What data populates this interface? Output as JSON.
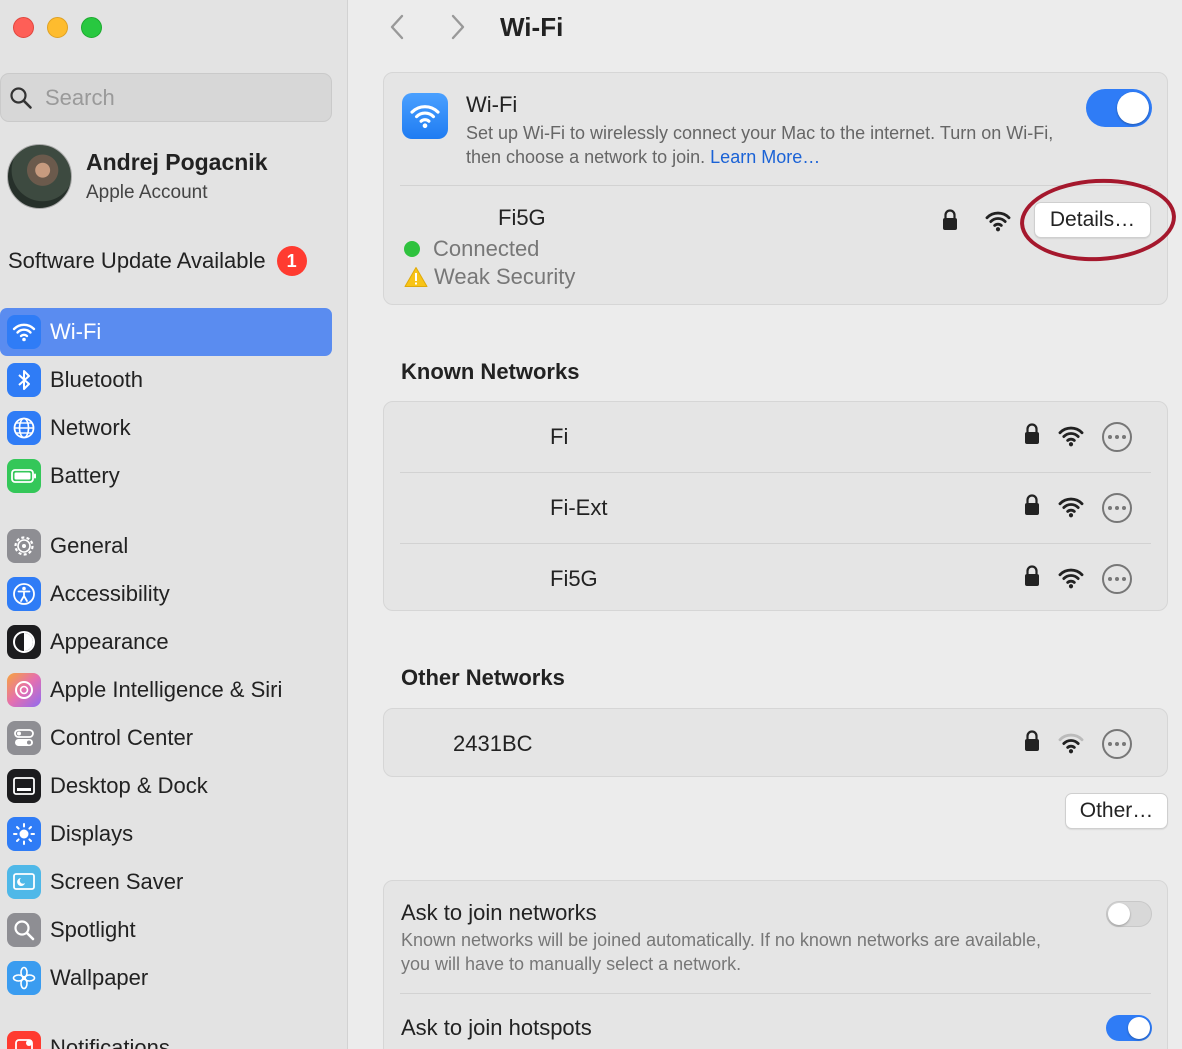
{
  "window": {
    "title": "Wi-Fi"
  },
  "search": {
    "placeholder": "Search"
  },
  "account": {
    "name": "Andrej Pogacnik",
    "subtitle": "Apple Account"
  },
  "update": {
    "label": "Software Update Available",
    "count": "1"
  },
  "sidebar": {
    "items": [
      {
        "label": "Wi-Fi",
        "icon": "wifi-icon",
        "color": "#2f7cf6"
      },
      {
        "label": "Bluetooth",
        "icon": "bluetooth-icon",
        "color": "#2f7cf6"
      },
      {
        "label": "Network",
        "icon": "globe-icon",
        "color": "#2f7cf6"
      },
      {
        "label": "Battery",
        "icon": "battery-icon",
        "color": "#34c759"
      },
      {
        "label": "General",
        "icon": "gear-icon",
        "color": "#8e8e93"
      },
      {
        "label": "Accessibility",
        "icon": "accessibility-icon",
        "color": "#2f7cf6"
      },
      {
        "label": "Appearance",
        "icon": "appearance-icon",
        "color": "#1c1c1e"
      },
      {
        "label": "Apple Intelligence & Siri",
        "icon": "siri-icon",
        "color": "#e46fb0"
      },
      {
        "label": "Control Center",
        "icon": "control-center-icon",
        "color": "#8e8e93"
      },
      {
        "label": "Desktop & Dock",
        "icon": "dock-icon",
        "color": "#1c1c1e"
      },
      {
        "label": "Displays",
        "icon": "displays-icon",
        "color": "#2f7cf6"
      },
      {
        "label": "Screen Saver",
        "icon": "screen-saver-icon",
        "color": "#4fb8e8"
      },
      {
        "label": "Spotlight",
        "icon": "spotlight-icon",
        "color": "#8e8e93"
      },
      {
        "label": "Wallpaper",
        "icon": "wallpaper-icon",
        "color": "#3a9cf0"
      },
      {
        "label": "Notifications",
        "icon": "notifications-icon",
        "color": "#ff3b30"
      }
    ]
  },
  "wifi": {
    "title": "Wi-Fi",
    "description": "Set up Wi-Fi to wirelessly connect your Mac to the internet. Turn on Wi-Fi, then choose a network to join.",
    "learn_more": "Learn More…",
    "enabled": true
  },
  "current": {
    "name": "Fi5G",
    "status": "Connected",
    "security": "Weak Security",
    "details_label": "Details…"
  },
  "known": {
    "title": "Known Networks",
    "networks": [
      {
        "name": "Fi"
      },
      {
        "name": "Fi-Ext"
      },
      {
        "name": "Fi5G"
      }
    ]
  },
  "other": {
    "title": "Other Networks",
    "networks": [
      {
        "name": "2431BC"
      }
    ],
    "other_label": "Other…"
  },
  "options": {
    "ask_join": {
      "title": "Ask to join networks",
      "description": "Known networks will be joined automatically. If no known networks are available, you will have to manually select a network.",
      "enabled": false
    },
    "ask_hotspots": {
      "title": "Ask to join hotspots",
      "enabled": true
    }
  }
}
